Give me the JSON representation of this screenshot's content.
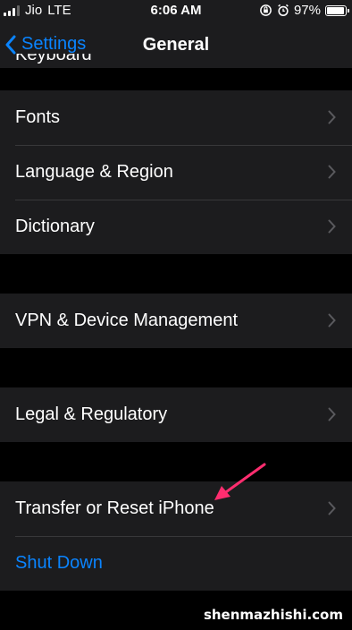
{
  "status_bar": {
    "carrier": "Jio",
    "network": "LTE",
    "time": "6:06 AM",
    "battery": "97%",
    "battery_level": 0.97
  },
  "nav": {
    "back_label": "Settings",
    "title": "General"
  },
  "partial_row": {
    "label": "Keyboard"
  },
  "groups": [
    {
      "rows": [
        {
          "label": "Fonts"
        },
        {
          "label": "Language & Region"
        },
        {
          "label": "Dictionary"
        }
      ]
    },
    {
      "rows": [
        {
          "label": "VPN & Device Management"
        }
      ]
    },
    {
      "rows": [
        {
          "label": "Legal & Regulatory"
        }
      ]
    },
    {
      "rows": [
        {
          "label": "Transfer or Reset iPhone"
        },
        {
          "label": "Shut Down"
        }
      ]
    }
  ],
  "watermark": "shenmazhishi.com",
  "colors": {
    "accent": "#0a84ff",
    "annotation_arrow": "#ff2d6f",
    "cell_bg": "#1c1c1e",
    "page_bg": "#000000"
  }
}
